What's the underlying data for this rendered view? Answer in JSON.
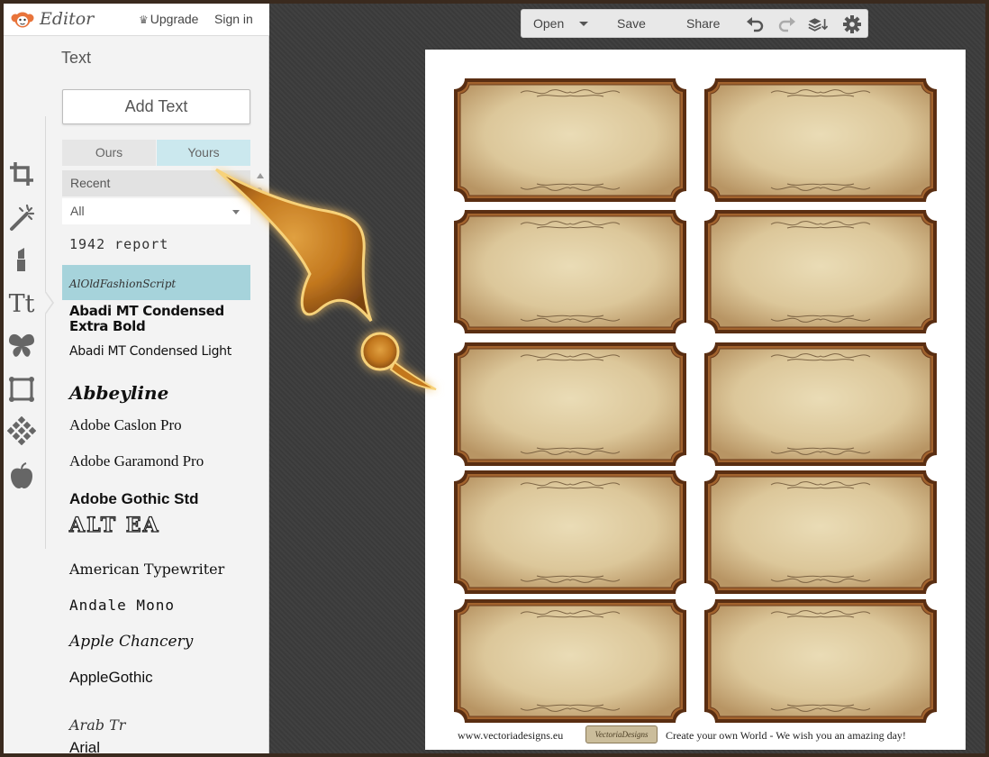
{
  "app": {
    "title": "Editor",
    "upgrade_label": "Upgrade",
    "signin_label": "Sign in"
  },
  "panel": {
    "title": "Text",
    "add_text_label": "Add Text",
    "tabs": [
      {
        "label": "Ours",
        "active": false
      },
      {
        "label": "Yours",
        "active": true
      }
    ],
    "filter_recent": "Recent",
    "filter_all": "All"
  },
  "fonts": [
    {
      "label": "1942 report"
    },
    {
      "label": "AlOldFashionScript",
      "selected": true
    },
    {
      "label": "Abadi MT Condensed Extra Bold"
    },
    {
      "label": "Abadi MT Condensed Light"
    },
    {
      "label": "Abbeyline"
    },
    {
      "label": "Adobe Caslon Pro"
    },
    {
      "label": "Adobe Garamond Pro"
    },
    {
      "label": "Adobe Gothic Std"
    },
    {
      "label": "ALT EA"
    },
    {
      "label": "American Typewriter"
    },
    {
      "label": "Andale Mono"
    },
    {
      "label": "Apple Chancery"
    },
    {
      "label": "AppleGothic"
    },
    {
      "label": "Arab Tr"
    },
    {
      "label": "Arial"
    }
  ],
  "toolbar": {
    "open_label": "Open",
    "save_label": "Save",
    "share_label": "Share"
  },
  "canvas": {
    "label_count": 10,
    "footer_website": "www.vectoriadesigns.eu",
    "footer_logo_text": "VectoriaDesigns",
    "footer_tagline": "Create your own World - We wish you an amazing day!"
  },
  "colors": {
    "selected_font_bg": "#a6d3db",
    "active_tab_bg": "#cbe8ee",
    "label_parchment": "#e0cfa6",
    "label_frame": "#6a3a1a",
    "workspace_bg": "#3c3c3c"
  }
}
